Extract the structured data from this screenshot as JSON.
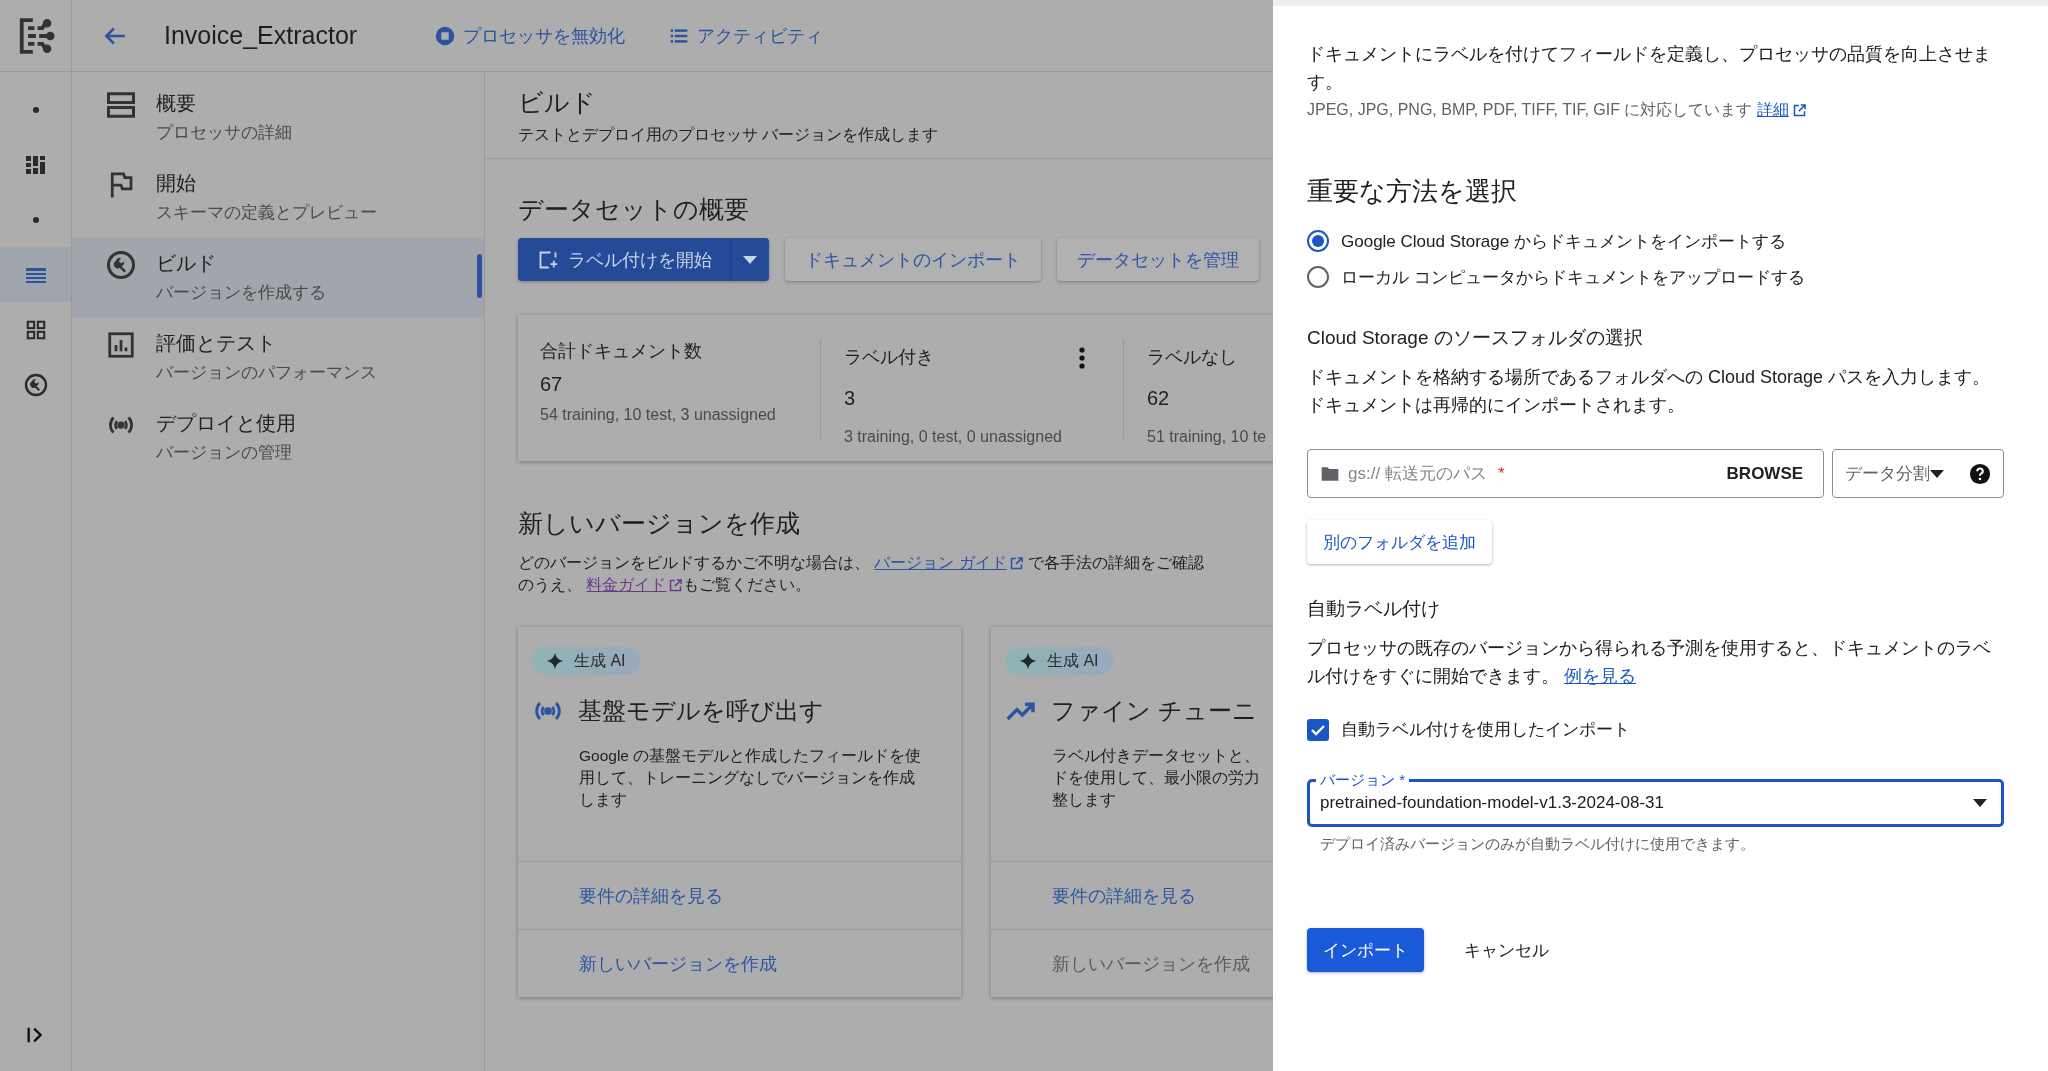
{
  "rail": {
    "items": [
      {
        "kind": "dot",
        "selected": false
      },
      {
        "kind": "dashboard",
        "selected": false
      },
      {
        "kind": "dot",
        "selected": false
      },
      {
        "kind": "list",
        "selected": true
      },
      {
        "kind": "grid",
        "selected": false
      },
      {
        "kind": "wrench",
        "selected": false
      }
    ]
  },
  "header": {
    "title": "Invoice_Extractor",
    "actions": [
      {
        "kind": "stop",
        "label": "プロセッサを無効化"
      },
      {
        "kind": "list",
        "label": "アクティビティ"
      }
    ]
  },
  "nav": {
    "items": [
      {
        "kind": "overview",
        "title": "概要",
        "subtitle": "プロセッサの詳細",
        "selected": false
      },
      {
        "kind": "flag",
        "title": "開始",
        "subtitle": "スキーマの定義とプレビュー",
        "selected": false
      },
      {
        "kind": "wrench",
        "title": "ビルド",
        "subtitle": "バージョンを作成する",
        "selected": true
      },
      {
        "kind": "chart",
        "title": "評価とテスト",
        "subtitle": "バージョンのパフォーマンス",
        "selected": false
      },
      {
        "kind": "broadcast",
        "title": "デプロイと使用",
        "subtitle": "バージョンの管理",
        "selected": false
      }
    ]
  },
  "page": {
    "title": "ビルド",
    "subtitle": "テストとデプロイ用のプロセッサ バージョンを作成します"
  },
  "dataset": {
    "title": "データセットの概要",
    "buttons": [
      {
        "kind": "primary",
        "label": "ラベル付けを開始"
      },
      {
        "kind": "outline",
        "label": "ドキュメントのインポート"
      },
      {
        "kind": "outline",
        "label": "データセットを管理"
      }
    ],
    "stats": [
      {
        "label": "合計ドキュメント数",
        "value": "67",
        "detail": "54 training, 10 test, 3 unassigned"
      },
      {
        "label": "ラベル付き",
        "value": "3",
        "detail": "3 training, 0 test, 0 unassigned",
        "menu": true
      },
      {
        "label": "ラベルなし",
        "value": "62",
        "detail": "51 training, 10 te"
      }
    ]
  },
  "new_version": {
    "title": "新しいバージョンを作成",
    "paragraph": [
      {
        "kind": "text",
        "text": "どのバージョンをビルドするかご不明な場合は、 "
      },
      {
        "kind": "link",
        "text": "バージョン ガイド"
      },
      {
        "kind": "text",
        "text": " で各手法の詳細をご確認のうえ、 "
      },
      {
        "kind": "link",
        "text": "料金ガイド"
      },
      {
        "kind": "text",
        "text": "もご覧ください。"
      }
    ]
  },
  "cards": [
    {
      "badge": "生成 AI",
      "kind": "broadcast",
      "title": "基盤モデルを呼び出す",
      "description": [
        "Google の基盤モデルと作成したフィールドを使",
        "用して、トレーニングなしでバージョンを作成",
        "します"
      ],
      "actions": [
        {
          "label": "要件の詳細を見る",
          "disabled": false
        },
        {
          "label": "新しいバージョンを作成",
          "disabled": false
        }
      ]
    },
    {
      "badge": "生成 AI",
      "kind": "trend",
      "title": "ファイン チューニ",
      "description": [
        "ラベル付きデータセットと、",
        "ドを使用して、最小限の労力",
        "整します"
      ],
      "actions": [
        {
          "label": "要件の詳細を見る",
          "disabled": false
        },
        {
          "label": "新しいバージョンを作成",
          "disabled": true
        }
      ]
    }
  ],
  "panel": {
    "intro": "ドキュメントにラベルを付けてフィールドを定義し、プロセッサの品質を向上させます。",
    "formats": {
      "text": "JPEG, JPG, PNG, BMP, PDF, TIFF, TIF, GIF に対応しています",
      "link": "詳細"
    },
    "method_title": "重要な方法を選択",
    "methods": [
      {
        "label": "Google Cloud Storage からドキュメントをインポートする",
        "selected": true
      },
      {
        "label": "ローカル コンピュータからドキュメントをアップロードする",
        "selected": false
      }
    ],
    "source": {
      "title": "Cloud Storage のソースフォルダの選択",
      "description": "ドキュメントを格納する場所であるフォルダへの Cloud Storage パスを入力します。ドキュメントは再帰的にインポートされます。",
      "path_field": {
        "placeholder": "gs:// 転送元のパス",
        "required_mark": "*",
        "button": "BROWSE"
      },
      "split_select": {
        "label": "データ分割"
      },
      "add_button": "別のフォルダを追加"
    },
    "auto_label": {
      "title": "自動ラベル付け",
      "description": "プロセッサの既存のバージョンから得られる予測を使用すると、ドキュメントのラベル付けをすぐに開始できます。",
      "link": "例を見る",
      "checkbox": {
        "label": "自動ラベル付けを使用したインポート",
        "checked": true
      },
      "version_select": {
        "label": "バージョン",
        "required_mark": "*",
        "value": "pretrained-foundation-model-v1.3-2024-08-31",
        "helper": "デプロイ済みバージョンのみが自動ラベル付けに使用できます。"
      }
    },
    "buttons": [
      {
        "kind": "primary",
        "label": "インポート"
      },
      {
        "kind": "text",
        "label": "キャンセル"
      }
    ]
  }
}
